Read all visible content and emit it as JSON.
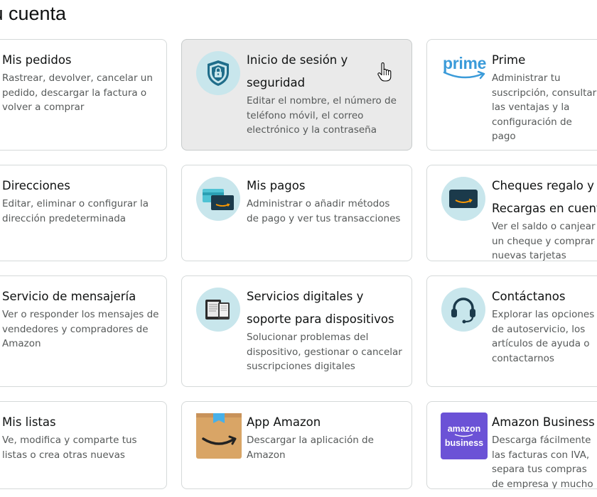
{
  "page": {
    "title": "Tu cuenta"
  },
  "cards": [
    {
      "title": "Mis pedidos",
      "desc": "Rastrear, devolver, cancelar un pedido, descargar la factura o volver a comprar",
      "icon": ""
    },
    {
      "title": "Inicio de sesión y seguridad",
      "desc": "Editar el nombre, el número de teléfono móvil, el correo electrónico y la contraseña",
      "icon": "shield-lock-icon"
    },
    {
      "title": "Prime",
      "desc": "Administrar tu suscripción, consultar las ventajas y la configuración de pago",
      "icon": "prime-logo-icon",
      "logo_text": "prime"
    },
    {
      "title": "Direcciones",
      "desc": "Editar, eliminar o configurar la dirección predeterminada",
      "icon": ""
    },
    {
      "title": "Mis pagos",
      "desc": "Administrar o añadir métodos de pago y ver tus transacciones",
      "icon": "payment-cards-icon"
    },
    {
      "title": "Cheques regalo y Recargas en cuenta",
      "desc": "Ver el saldo o canjear un cheque y comprar nuevas tarjetas",
      "icon": "gift-card-icon"
    },
    {
      "title": "Servicio de mensajería",
      "desc": "Ver o responder los mensajes de vendedores y compradores de Amazon",
      "icon": ""
    },
    {
      "title": "Servicios digitales y soporte para dispositivos",
      "desc": "Solucionar problemas del dispositivo, gestionar o cancelar suscripciones digitales",
      "icon": "devices-icon"
    },
    {
      "title": "Contáctanos",
      "desc": "Explorar las opciones de autoservicio, los artículos de ayuda o contactarnos",
      "icon": "headset-icon"
    },
    {
      "title": "Mis listas",
      "desc": "Ve, modifica y comparte tus listas o crea otras nuevas",
      "icon": ""
    },
    {
      "title": "App Amazon",
      "desc": "Descargar la aplicación de Amazon",
      "icon": "amazon-app-icon"
    },
    {
      "title": "Amazon Business",
      "desc": "Descarga fácilmente las facturas con IVA, separa tus compras de empresa y mucho más",
      "icon": "amazon-business-icon",
      "logo_line1": "amazon",
      "logo_line2": "business"
    }
  ]
}
